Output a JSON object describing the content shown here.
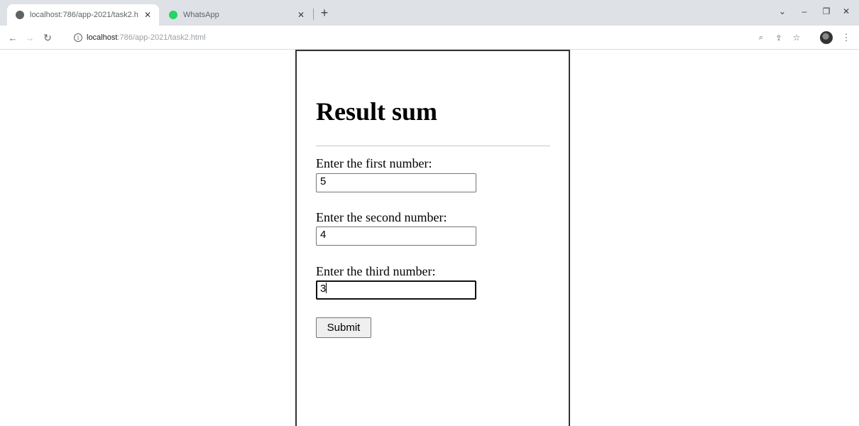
{
  "browser": {
    "tabs": [
      {
        "title": "localhost:786/app-2021/task2.h",
        "favicon_color": "#5f6368",
        "active": true
      },
      {
        "title": "WhatsApp",
        "favicon_color": "#25d366",
        "active": false
      }
    ],
    "new_tab_symbol": "+",
    "url": {
      "host": "localhost",
      "path": ":786/app-2021/task2.html"
    },
    "window_controls": {
      "minimize": "–",
      "restore": "❐",
      "close": "✕",
      "dropdown": "⌄"
    }
  },
  "form": {
    "heading": "Result sum",
    "fields": [
      {
        "label": "Enter the first number:",
        "value": "5"
      },
      {
        "label": "Enter the second number:",
        "value": "4"
      },
      {
        "label": "Enter the third number:",
        "value": "3"
      }
    ],
    "submit_label": "Submit"
  }
}
